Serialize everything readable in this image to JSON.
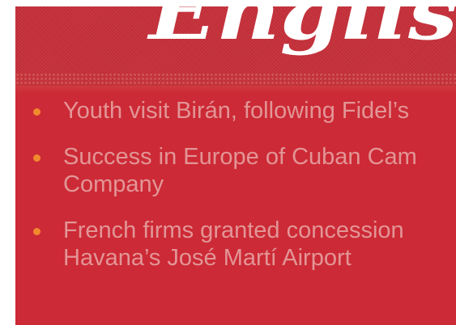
{
  "slide": {
    "logo_text": "English",
    "colors": {
      "background": "#cc2a36",
      "header": "#c6303a",
      "text": "#e39596",
      "bullet": "#f08a2c"
    },
    "bullets": [
      {
        "lines": [
          "Youth visit Birán, following Fidel’s"
        ]
      },
      {
        "lines": [
          "Success in Europe of Cuban Cam",
          "Company"
        ]
      },
      {
        "lines": [
          "French firms granted concession",
          "Havana’s José Martí Airport"
        ]
      }
    ]
  }
}
